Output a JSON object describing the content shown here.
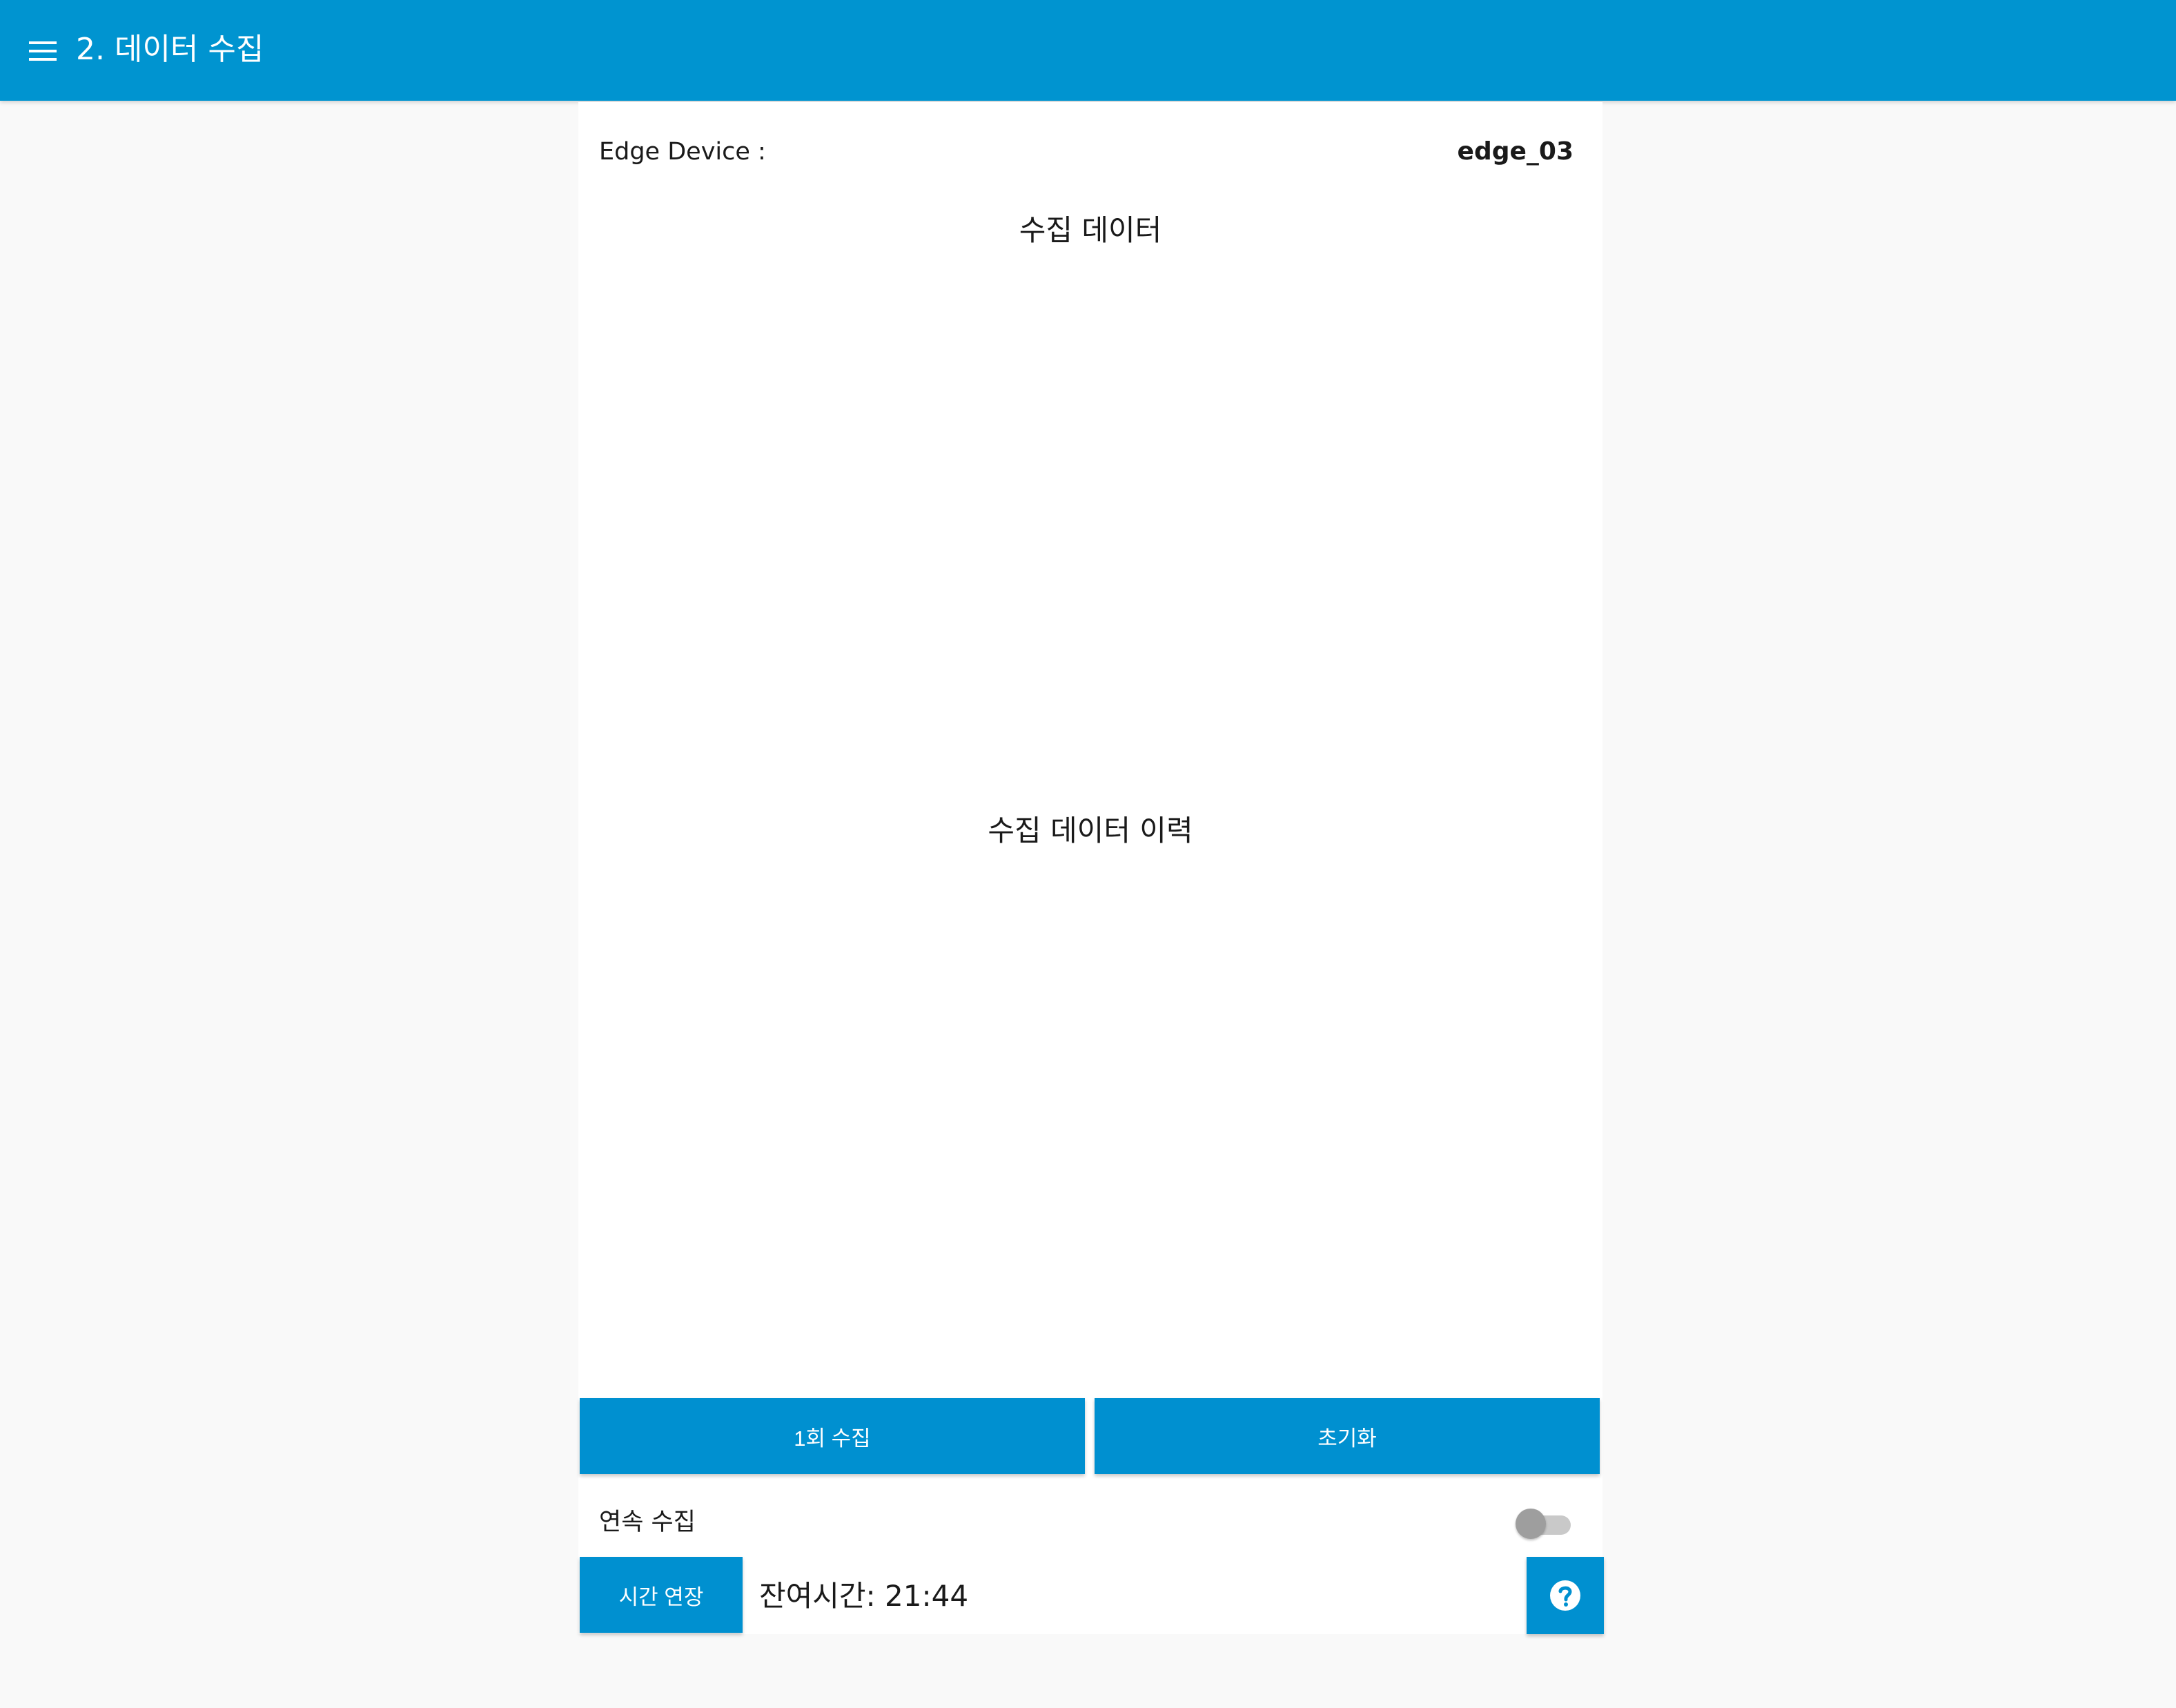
{
  "header": {
    "title": "2. 데이터 수집",
    "menu_icon": "hamburger-menu-icon",
    "background_color": "#0094d0"
  },
  "device": {
    "label": "Edge Device :",
    "value": "edge_03"
  },
  "sections": {
    "collected_data_title": "수집 데이터",
    "history_title": "수집 데이터 이력"
  },
  "actions": {
    "collect_once_label": "1회 수집",
    "reset_label": "초기화",
    "extend_time_label": "시간 연장",
    "help_icon": "help-circle-icon"
  },
  "continuous": {
    "label": "연속 수집",
    "enabled": false
  },
  "timer": {
    "remaining_text": "잔여시간: 21:44"
  },
  "colors": {
    "accent": "#0090d0",
    "page_background": "#f9f9f9",
    "panel_background": "#ffffff"
  }
}
